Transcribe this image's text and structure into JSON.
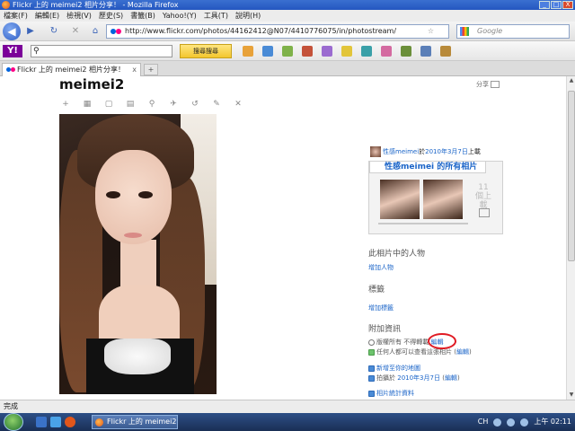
{
  "window": {
    "title": "Flickr 上的 meimei2 相片分享！ - Mozilla Firefox",
    "buttons": [
      "_",
      "□",
      "X"
    ]
  },
  "menu": [
    "檔案(F)",
    "編輯(E)",
    "檢視(V)",
    "歷史(S)",
    "書籤(B)",
    "Yahoo!(Y)",
    "工具(T)",
    "說明(H)"
  ],
  "nav": {
    "url": "http://www.flickr.com/photos/44162412@N07/4410776075/in/photostream/",
    "search_placeholder": "Google",
    "back": "◀",
    "forward": "▶",
    "reload": "↻",
    "stop": "✕",
    "home": "⌂"
  },
  "yahoo_toolbar": {
    "logo": "Y!",
    "button": "搜尋搜尋",
    "icon_colors": [
      "#e8a23a",
      "#4a8bd6",
      "#7fb24a",
      "#c4523a",
      "#9b6bd0",
      "#e2c53a",
      "#3aa0a8",
      "#d46aa0",
      "#6b8f3a",
      "#5b7fb8",
      "#b88a3a"
    ]
  },
  "tab": {
    "label": "Flickr 上的 meimei2 相片分享！",
    "close": "x",
    "new": "+"
  },
  "page": {
    "title": "meimei2",
    "share": "分享",
    "actions": [
      "+",
      "▦",
      "▢",
      "▤",
      "⚲",
      "✈",
      "↺",
      "✎",
      "✕"
    ]
  },
  "sidebar": {
    "owner_name": "性感meimei",
    "owner_prefix": "於",
    "owner_date": "2010年3月7日",
    "owner_suffix": "上載",
    "stream_title": "性感meimei 的所有相片",
    "more_count": "11",
    "more_label": "個上載",
    "people_title": "此相片中的人物",
    "people_link": "增加人物",
    "tags_title": "標籤",
    "tags_link": "增加標籤",
    "extra_title": "附加資訊",
    "copyright_text": "版權所有 不得轉載",
    "edit_link": "編輯",
    "everyone_text": "任何人都可以查看這張相片 (",
    "everyone_edit": "編輯",
    "map_link": "新增至你的地圖",
    "taken_prefix": "拍攝於",
    "taken_date": "2010年3月7日",
    "taken_edit": "編輯",
    "stats_link": "相片統計資料"
  },
  "status": "完成",
  "taskbar": {
    "item": "Flickr 上的 meimei2...",
    "lang": "CH",
    "clock": "上午 02:11"
  }
}
